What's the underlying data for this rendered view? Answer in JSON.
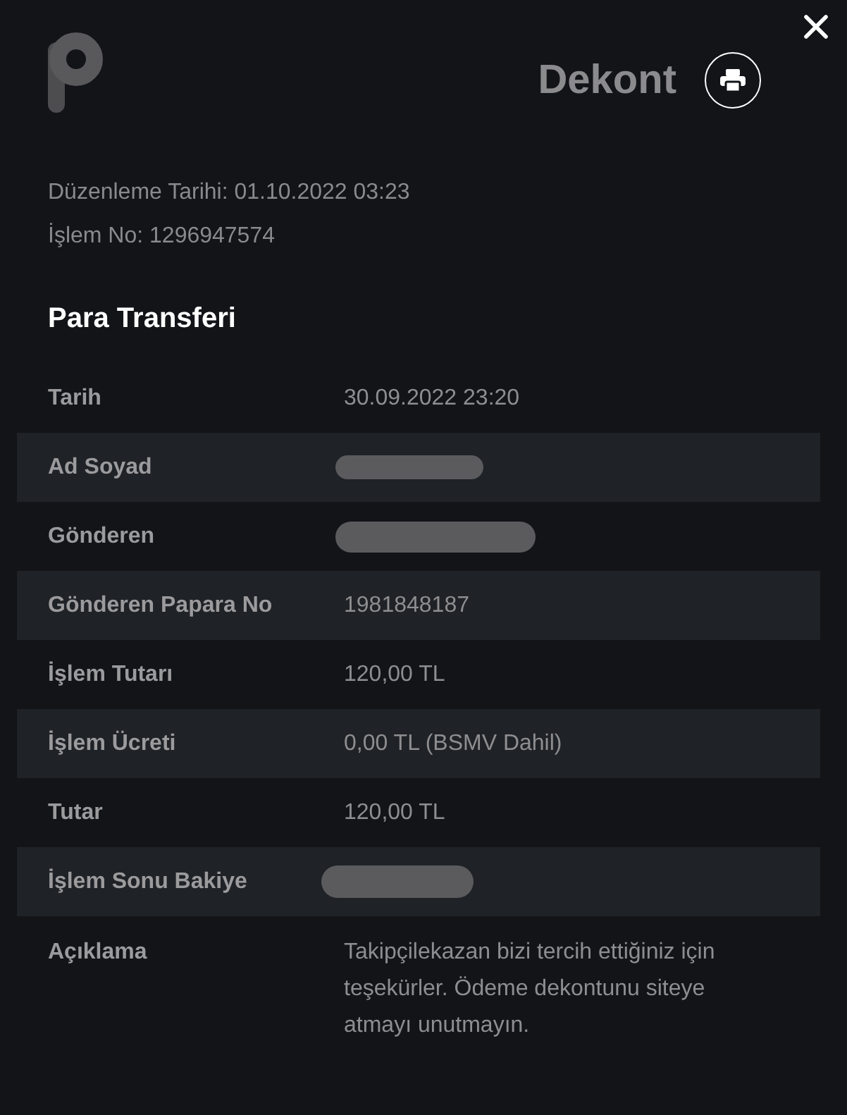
{
  "header": {
    "title": "Dekont"
  },
  "meta": [
    "Düzenleme Tarihi: 01.10.2022 03:23",
    "İşlem No: 1296947574"
  ],
  "section": {
    "title": "Para Transferi"
  },
  "rows": [
    {
      "label": "Tarih",
      "kind": "text",
      "value": "30.09.2022 23:20"
    },
    {
      "label": "Ad Soyad",
      "kind": "redacted"
    },
    {
      "label": "Gönderen",
      "kind": "redacted"
    },
    {
      "label": "Gönderen Papara No",
      "kind": "text",
      "value": "1981848187"
    },
    {
      "label": "İşlem Tutarı",
      "kind": "text",
      "value": "120,00 TL"
    },
    {
      "label": "İşlem Ücreti",
      "kind": "text",
      "value": "0,00 TL (BSMV Dahil)"
    },
    {
      "label": "Tutar",
      "kind": "text",
      "value": "120,00 TL"
    },
    {
      "label": "İşlem Sonu Bakiye",
      "kind": "redacted"
    },
    {
      "label": "Açıklama",
      "kind": "text",
      "value": "Takipçilekazan bizi tercih ettiğiniz için teşekürler. Ödeme dekontunu siteye atmayı unutmayın."
    }
  ]
}
